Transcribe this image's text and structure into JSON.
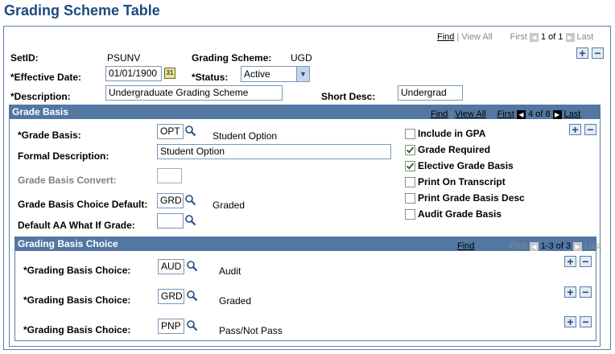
{
  "page": {
    "title": "Grading Scheme Table"
  },
  "top_nav": {
    "find": "Find",
    "view_all": "View All",
    "first": "First",
    "count": "1 of 1",
    "last": "Last"
  },
  "header_fields": {
    "setid_label": "SetID:",
    "setid_value": "PSUNV",
    "scheme_label": "Grading Scheme:",
    "scheme_value": "UGD",
    "eff_date_label": "*Effective Date:",
    "eff_date_value": "01/01/1900",
    "status_label": "*Status:",
    "status_value": "Active",
    "desc_label": "*Description:",
    "desc_value": "Undergraduate Grading Scheme",
    "short_desc_label": "Short Desc:",
    "short_desc_value": "Undergrad"
  },
  "grade_basis": {
    "header": "Grade Basis",
    "nav": {
      "find": "Find",
      "view_all": "View All",
      "first": "First",
      "count": "4 of 8",
      "last": "Last"
    },
    "grade_basis_label": "*Grade Basis:",
    "grade_basis_value": "OPT",
    "grade_basis_desc": "Student Option",
    "formal_desc_label": "Formal Description:",
    "formal_desc_value": "Student Option",
    "convert_label": "Grade Basis Convert:",
    "convert_value": "",
    "choice_default_label": "Grade Basis Choice Default:",
    "choice_default_value": "GRD",
    "choice_default_desc": "Graded",
    "aa_whatif_label": "Default AA What If Grade:",
    "aa_whatif_value": "",
    "checkboxes": [
      {
        "label": "Include in GPA",
        "checked": false
      },
      {
        "label": "Grade Required",
        "checked": true
      },
      {
        "label": "Elective Grade Basis",
        "checked": true
      },
      {
        "label": "Print On Transcript",
        "checked": false
      },
      {
        "label": "Print Grade Basis Desc",
        "checked": false
      },
      {
        "label": "Audit Grade Basis",
        "checked": false
      }
    ]
  },
  "grading_basis_choice": {
    "header": "Grading Basis Choice",
    "nav": {
      "find": "Find",
      "first": "First",
      "count": "1-3 of 3",
      "last": "Last"
    },
    "rows": [
      {
        "label": "*Grading Basis Choice:",
        "code": "AUD",
        "desc": "Audit"
      },
      {
        "label": "*Grading Basis Choice:",
        "code": "GRD",
        "desc": "Graded"
      },
      {
        "label": "*Grading Basis Choice:",
        "code": "PNP",
        "desc": "Pass/Not Pass"
      }
    ]
  }
}
